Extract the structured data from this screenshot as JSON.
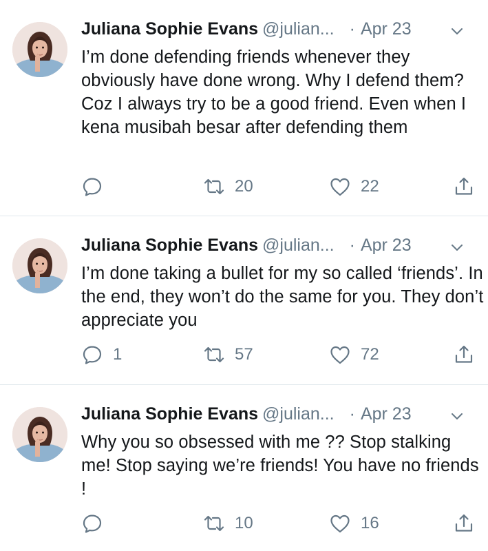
{
  "tweets": [
    {
      "name": "Juliana Sophie Evans",
      "handle": "@julian...",
      "separator": "·",
      "date": "Apr 23",
      "text": "I’m done defending friends whenever they obviously have done wrong. Why I defend them? Coz I always try to be a good friend. Even when I kena musibah besar after defending them",
      "replies": "",
      "retweets": "20",
      "likes": "22"
    },
    {
      "name": "Juliana Sophie Evans",
      "handle": "@julian...",
      "separator": "·",
      "date": "Apr 23",
      "text": "I’m done taking a bullet for my so called ‘friends’. In the end, they won’t do the same for you. They don’t appreciate you",
      "replies": "1",
      "retweets": "57",
      "likes": "72"
    },
    {
      "name": "Juliana Sophie Evans",
      "handle": "@julian...",
      "separator": "·",
      "date": "Apr 23",
      "text": "Why you so obsessed with me ?? Stop stalking me! Stop saying we’re friends! You have no friends !",
      "replies": "",
      "retweets": "10",
      "likes": "16"
    }
  ],
  "icons": {
    "reply": "reply-icon",
    "retweet": "retweet-icon",
    "like": "heart-icon",
    "share": "share-icon",
    "caret": "chevron-down-icon"
  },
  "colors": {
    "text": "#14171a",
    "secondary": "#657786",
    "divider": "#e1e8ed"
  }
}
